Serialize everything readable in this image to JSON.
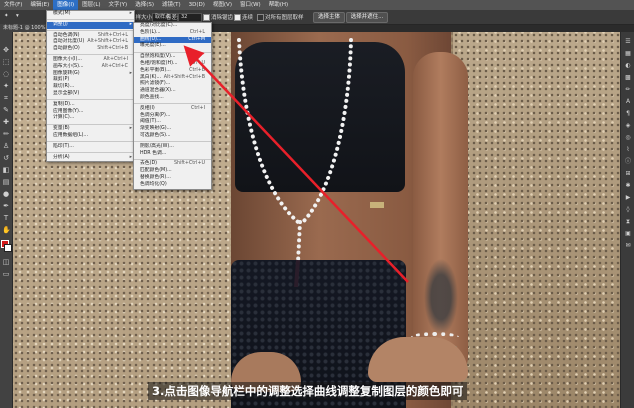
{
  "menubar": {
    "items": [
      "文件(F)",
      "编辑(E)",
      "图像(I)",
      "图层(L)",
      "文字(Y)",
      "选择(S)",
      "滤镜(T)",
      "3D(D)",
      "视图(V)",
      "窗口(W)",
      "帮助(H)"
    ],
    "active_index": 2
  },
  "options": {
    "size_label": "取样大小:",
    "size_value": "取样点",
    "tolerance_label": "容差:",
    "tolerance_value": "32",
    "antialias": "消除锯齿",
    "contiguous": "连续",
    "all_layers": "对所有图层取样",
    "select_subject": "选择主体",
    "select_mask": "选择并遮住..."
  },
  "doc_tab": "未标题-1 @ 100%",
  "image_menu": {
    "items": [
      {
        "label": "模式(M)",
        "arrow": true
      },
      {
        "sep": true
      },
      {
        "label": "调整(J)",
        "arrow": true,
        "highlight": true
      },
      {
        "sep": true
      },
      {
        "label": "自动色调(N)",
        "shortcut": "Shift+Ctrl+L"
      },
      {
        "label": "自动对比度(U)",
        "shortcut": "Alt+Shift+Ctrl+L"
      },
      {
        "label": "自动颜色(O)",
        "shortcut": "Shift+Ctrl+B"
      },
      {
        "sep": true
      },
      {
        "label": "图像大小(I)...",
        "shortcut": "Alt+Ctrl+I"
      },
      {
        "label": "画布大小(S)...",
        "shortcut": "Alt+Ctrl+C"
      },
      {
        "label": "图像旋转(G)",
        "arrow": true
      },
      {
        "label": "裁剪(P)"
      },
      {
        "label": "裁切(R)..."
      },
      {
        "label": "显示全部(V)"
      },
      {
        "sep": true
      },
      {
        "label": "复制(D)..."
      },
      {
        "label": "应用图像(Y)..."
      },
      {
        "label": "计算(C)..."
      },
      {
        "sep": true
      },
      {
        "label": "变量(B)",
        "arrow": true
      },
      {
        "label": "应用数据组(L)..."
      },
      {
        "sep": true
      },
      {
        "label": "陷印(T)..."
      },
      {
        "sep": true
      },
      {
        "label": "分析(A)",
        "arrow": true
      }
    ]
  },
  "adjust_menu": {
    "items": [
      {
        "label": "亮度/对比度(C)..."
      },
      {
        "label": "色阶(L)...",
        "shortcut": "Ctrl+L"
      },
      {
        "label": "曲线(U)...",
        "shortcut": "Ctrl+M",
        "highlight": true
      },
      {
        "label": "曝光度(E)..."
      },
      {
        "sep": true
      },
      {
        "label": "自然饱和度(V)..."
      },
      {
        "label": "色相/饱和度(H)...",
        "shortcut": "Ctrl+U"
      },
      {
        "label": "色彩平衡(B)...",
        "shortcut": "Ctrl+B"
      },
      {
        "label": "黑白(K)...",
        "shortcut": "Alt+Shift+Ctrl+B"
      },
      {
        "label": "照片滤镜(F)..."
      },
      {
        "label": "通道混合器(X)..."
      },
      {
        "label": "颜色查找..."
      },
      {
        "sep": true
      },
      {
        "label": "反相(I)",
        "shortcut": "Ctrl+I"
      },
      {
        "label": "色调分离(P)..."
      },
      {
        "label": "阈值(T)..."
      },
      {
        "label": "渐变映射(G)..."
      },
      {
        "label": "可选颜色(S)..."
      },
      {
        "sep": true
      },
      {
        "label": "阴影/高光(W)..."
      },
      {
        "label": "HDR 色调..."
      },
      {
        "sep": true
      },
      {
        "label": "去色(D)",
        "shortcut": "Shift+Ctrl+U"
      },
      {
        "label": "匹配颜色(M)..."
      },
      {
        "label": "替换颜色(R)..."
      },
      {
        "label": "色调均化(Q)"
      }
    ]
  },
  "caption": "3.点击图像导航栏中的调整选择曲线调整复制图层的颜色即可",
  "colors": {
    "foreground": "#d41b1b",
    "background": "#ffffff",
    "arrow": "#e8202a",
    "highlight": "#2f6bc4"
  }
}
